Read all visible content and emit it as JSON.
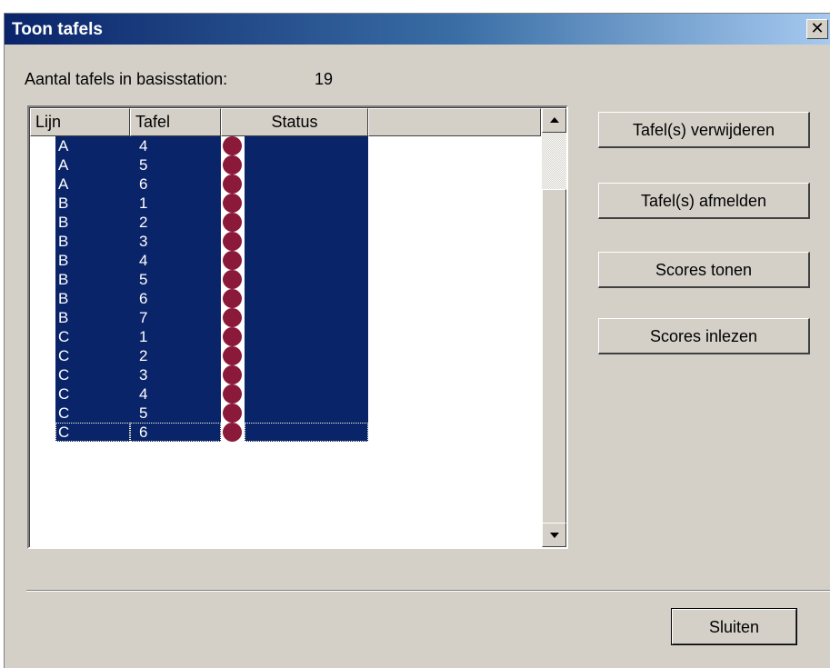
{
  "window": {
    "title": "Toon tafels",
    "close_glyph": "✕"
  },
  "info": {
    "count_label": "Aantal tafels in basisstation:",
    "count_value": "19"
  },
  "table": {
    "columns": [
      "Lijn",
      "Tafel",
      "Status",
      ""
    ],
    "status_color": "#8b1a3a",
    "selection_color": "#0a246a",
    "rows": [
      {
        "lijn": "A",
        "tafel": "4"
      },
      {
        "lijn": "A",
        "tafel": "5"
      },
      {
        "lijn": "A",
        "tafel": "6"
      },
      {
        "lijn": "B",
        "tafel": "1"
      },
      {
        "lijn": "B",
        "tafel": "2"
      },
      {
        "lijn": "B",
        "tafel": "3"
      },
      {
        "lijn": "B",
        "tafel": "4"
      },
      {
        "lijn": "B",
        "tafel": "5"
      },
      {
        "lijn": "B",
        "tafel": "6"
      },
      {
        "lijn": "B",
        "tafel": "7"
      },
      {
        "lijn": "C",
        "tafel": "1"
      },
      {
        "lijn": "C",
        "tafel": "2"
      },
      {
        "lijn": "C",
        "tafel": "3"
      },
      {
        "lijn": "C",
        "tafel": "4"
      },
      {
        "lijn": "C",
        "tafel": "5"
      },
      {
        "lijn": "C",
        "tafel": "6"
      }
    ]
  },
  "buttons": {
    "remove": "Tafel(s) verwijderen",
    "logoff": "Tafel(s) afmelden",
    "show_scores": "Scores tonen",
    "read_scores": "Scores inlezen",
    "close": "Sluiten"
  }
}
